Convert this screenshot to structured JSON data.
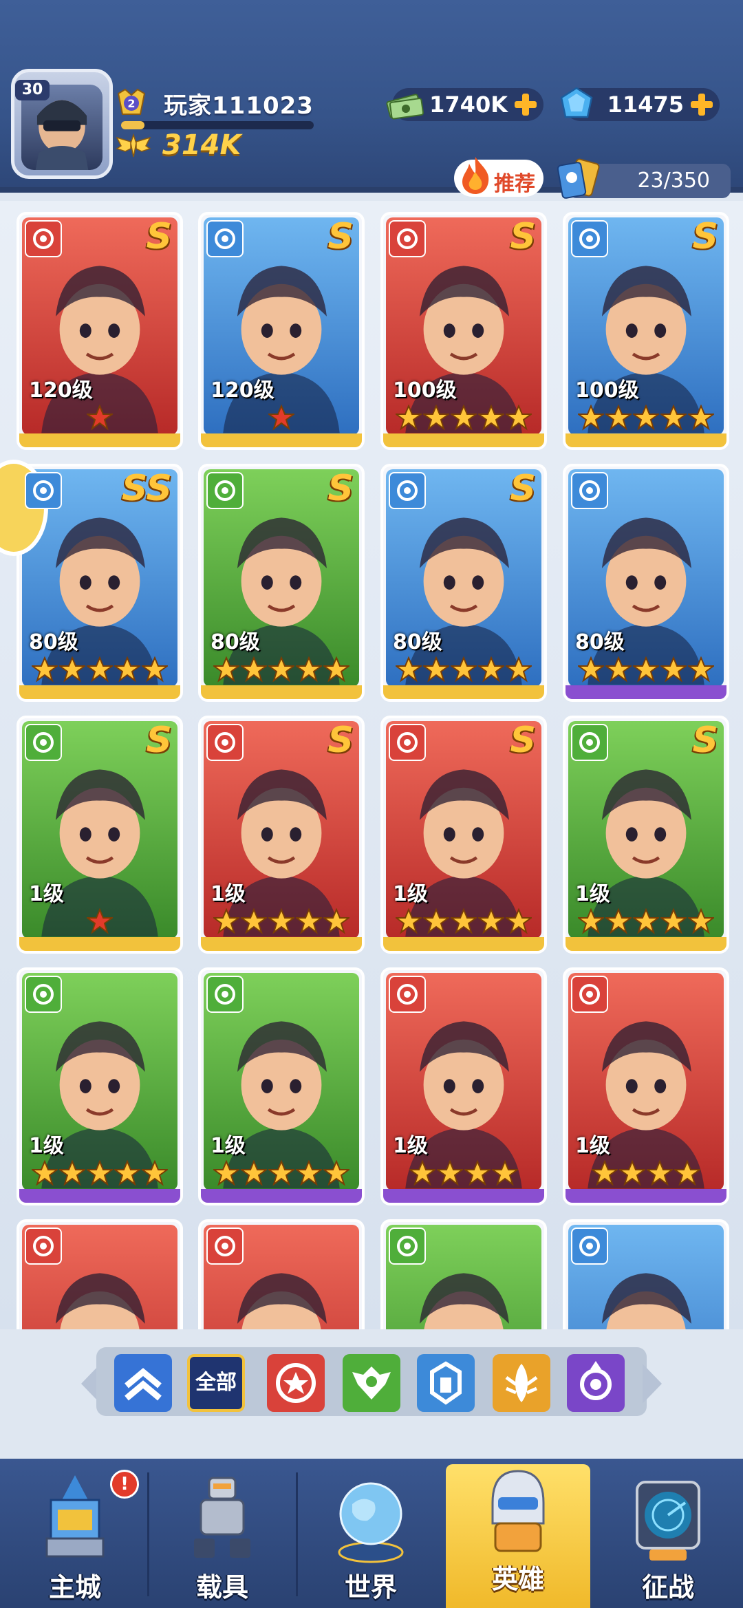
{
  "player": {
    "level": "30",
    "rank": "2",
    "name": "玩家111023",
    "power": "314K",
    "xp_fraction": 0.12
  },
  "currencies": [
    {
      "name": "cash-icon",
      "value": "1740K"
    },
    {
      "name": "diamond-icon",
      "value": "11475"
    }
  ],
  "toolbar": {
    "recommend_label": "推荐",
    "hero_count": "23/350"
  },
  "heroes": [
    {
      "faction": "red",
      "rarity": "S",
      "level": "120级",
      "stars": 1,
      "star_color": "red",
      "bg": "red",
      "bottom": "yellow"
    },
    {
      "faction": "blue",
      "rarity": "S",
      "level": "120级",
      "stars": 1,
      "star_color": "red",
      "bg": "blue",
      "bottom": "yellow"
    },
    {
      "faction": "red",
      "rarity": "S",
      "level": "100级",
      "stars": 5,
      "star_color": "gold",
      "bg": "red",
      "bottom": "yellow"
    },
    {
      "faction": "blue",
      "rarity": "S",
      "level": "100级",
      "stars": 5,
      "star_color": "gold",
      "bg": "blue",
      "bottom": "yellow"
    },
    {
      "faction": "blue",
      "rarity": "SS",
      "level": "80级",
      "stars": 5,
      "star_color": "gold",
      "bg": "blue",
      "bottom": "yellow"
    },
    {
      "faction": "green",
      "rarity": "S",
      "level": "80级",
      "stars": 5,
      "star_color": "gold",
      "bg": "green",
      "bottom": "yellow"
    },
    {
      "faction": "blue",
      "rarity": "S",
      "level": "80级",
      "stars": 5,
      "star_color": "gold",
      "bg": "blue",
      "bottom": "yellow"
    },
    {
      "faction": "blue",
      "rarity": "",
      "level": "80级",
      "stars": 5,
      "star_color": "gold",
      "bg": "blue",
      "bottom": "purple"
    },
    {
      "faction": "green",
      "rarity": "S",
      "level": "1级",
      "stars": 1,
      "star_color": "red",
      "bg": "green",
      "bottom": "yellow"
    },
    {
      "faction": "red",
      "rarity": "S",
      "level": "1级",
      "stars": 5,
      "star_color": "gold",
      "bg": "red",
      "bottom": "yellow"
    },
    {
      "faction": "red",
      "rarity": "S",
      "level": "1级",
      "stars": 5,
      "star_color": "gold",
      "bg": "red",
      "bottom": "yellow"
    },
    {
      "faction": "green",
      "rarity": "S",
      "level": "1级",
      "stars": 5,
      "star_color": "gold",
      "bg": "green",
      "bottom": "yellow"
    },
    {
      "faction": "green",
      "rarity": "",
      "level": "1级",
      "stars": 5,
      "star_color": "gold",
      "bg": "green",
      "bottom": "purple"
    },
    {
      "faction": "green",
      "rarity": "",
      "level": "1级",
      "stars": 5,
      "star_color": "gold",
      "bg": "green",
      "bottom": "purple"
    },
    {
      "faction": "red",
      "rarity": "",
      "level": "1级",
      "stars": 4,
      "star_color": "gold",
      "bg": "red",
      "bottom": "purple"
    },
    {
      "faction": "red",
      "rarity": "",
      "level": "1级",
      "stars": 4,
      "star_color": "gold",
      "bg": "red",
      "bottom": "purple"
    },
    {
      "faction": "red",
      "rarity": "",
      "level": "",
      "stars": 0,
      "star_color": "gold",
      "bg": "red",
      "bottom": "none"
    },
    {
      "faction": "red",
      "rarity": "",
      "level": "",
      "stars": 0,
      "star_color": "gold",
      "bg": "red",
      "bottom": "none"
    },
    {
      "faction": "green",
      "rarity": "",
      "level": "",
      "stars": 0,
      "star_color": "gold",
      "bg": "green",
      "bottom": "none"
    },
    {
      "faction": "blue",
      "rarity": "",
      "level": "",
      "stars": 0,
      "star_color": "gold",
      "bg": "blue",
      "bottom": "none"
    }
  ],
  "filters": [
    {
      "name": "filter-rank-icon",
      "label": ""
    },
    {
      "name": "filter-all",
      "label": "全部"
    },
    {
      "name": "filter-red-faction-icon",
      "label": ""
    },
    {
      "name": "filter-green-faction-icon",
      "label": ""
    },
    {
      "name": "filter-blue-faction-icon",
      "label": ""
    },
    {
      "name": "filter-gold-faction-icon",
      "label": ""
    },
    {
      "name": "filter-purple-faction-icon",
      "label": ""
    }
  ],
  "tabs": [
    {
      "name": "tab-main-city",
      "label": "主城",
      "icon": "castle-icon",
      "alert": "!"
    },
    {
      "name": "tab-vehicle",
      "label": "载具",
      "icon": "mech-icon"
    },
    {
      "name": "tab-world",
      "label": "世界",
      "icon": "globe-icon"
    },
    {
      "name": "tab-hero",
      "label": "英雄",
      "icon": "hero-helmet-icon",
      "active": true
    },
    {
      "name": "tab-campaign",
      "label": "征战",
      "icon": "radar-icon"
    }
  ],
  "colors": {
    "red": "#d9423a",
    "blue": "#3d8ad9",
    "green": "#4fae3a",
    "gold": "#ffc53a",
    "purple": "#8a4fd0",
    "yellow_strip": "#f2c23c"
  }
}
